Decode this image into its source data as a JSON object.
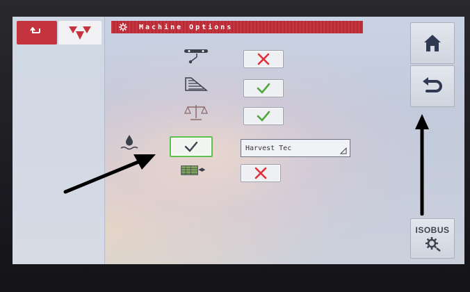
{
  "header": {
    "title": "Machine Options",
    "back_icon": "back-arrow-icon",
    "brand_icon": "brand-triangles-logo",
    "title_icon": "gear-icon"
  },
  "options": [
    {
      "icon": "sprayer-nozzle-icon",
      "state": "off"
    },
    {
      "icon": "bale-chamber-icon",
      "state": "on"
    },
    {
      "icon": "scale-icon",
      "state": "on"
    },
    {
      "icon": "moisture-drop-icon",
      "state": "on",
      "selected": true,
      "dropdown_value": "Harvest Tec"
    },
    {
      "icon": "bale-wrap-icon",
      "state": "off"
    }
  ],
  "sidebar": {
    "home_icon": "home-icon",
    "return_icon": "return-arrow-icon",
    "isobus_label": "ISOBUS",
    "isobus_icon": "gear-settings-icon"
  },
  "colors": {
    "accent_red": "#c4343e",
    "check_green": "#4aa83c",
    "cross_red": "#e0303a",
    "highlight_green": "#5cc04c"
  }
}
